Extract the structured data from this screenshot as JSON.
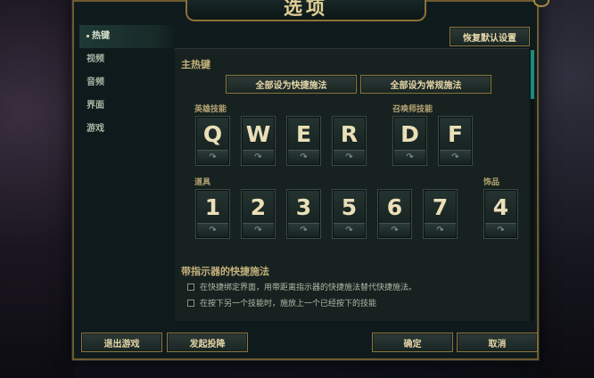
{
  "window": {
    "title": "选项"
  },
  "sidebar": {
    "items": [
      {
        "label": "热键",
        "active": true
      },
      {
        "label": "视频",
        "active": false
      },
      {
        "label": "音频",
        "active": false
      },
      {
        "label": "界面",
        "active": false
      },
      {
        "label": "游戏",
        "active": false
      }
    ]
  },
  "header": {
    "reset_label": "恢复默认设置"
  },
  "hotkeys": {
    "section_title": "主热键",
    "set_all_quick": "全部设为快捷施法",
    "set_all_normal": "全部设为常规施法",
    "champion_label": "英雄技能",
    "summoner_label": "召唤师技能",
    "items_label": "道具",
    "trinket_label": "饰品",
    "champion_keys": [
      "Q",
      "W",
      "E",
      "R"
    ],
    "summoner_keys": [
      "D",
      "F"
    ],
    "item_keys": [
      "1",
      "2",
      "3",
      "5",
      "6",
      "7"
    ],
    "trinket_key": "4",
    "sub_glyph": "↷"
  },
  "indicator": {
    "title": "带指示器的快捷施法",
    "option1": "在快捷绑定界面，用带距离指示器的快捷施法替代快捷施法。",
    "option2": "在按下另一个技能时，施放上一个已经按下的技能"
  },
  "footer": {
    "exit_label": "退出游戏",
    "surrender_label": "发起投降",
    "ok_label": "确定",
    "cancel_label": "取消"
  },
  "colors": {
    "accent_gold": "#8d7440",
    "scroll_teal": "#1d8a80",
    "panel_bg": "#172220"
  }
}
